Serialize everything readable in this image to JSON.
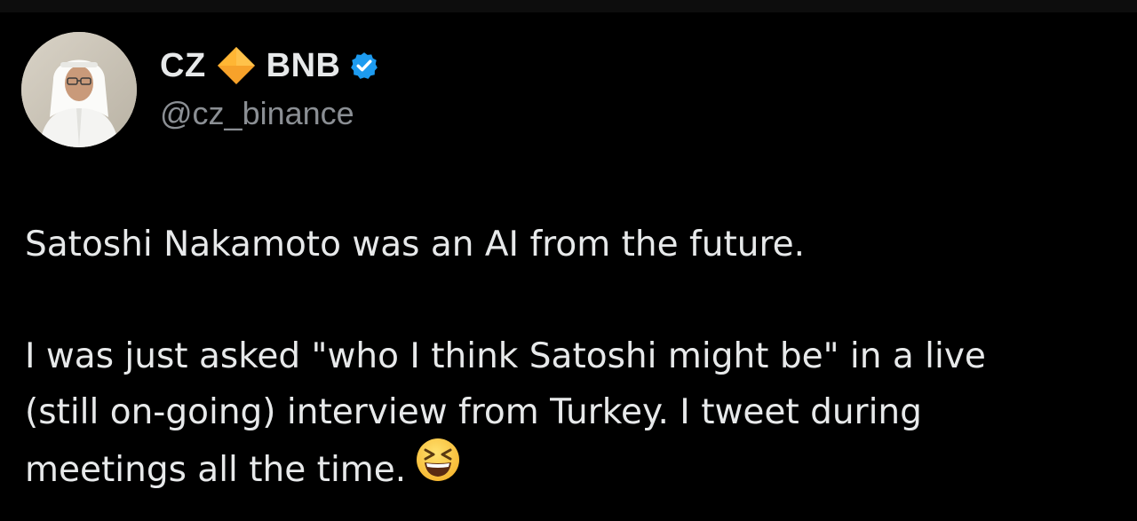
{
  "author": {
    "name_first": "CZ",
    "name_second": "BNB",
    "handle": "@cz_binance",
    "avatar_icon": "avatar-photo",
    "name_icon": "orange-diamond-icon",
    "verified_icon": "verified-badge-icon"
  },
  "tweet": {
    "line1": "Satoshi Nakamoto was an AI from the future.",
    "line2": "I was just asked \"who I think Satoshi might be\" in a live",
    "line3": "(still on-going) interview from Turkey. I tweet during",
    "line4": "meetings all the time.",
    "emoji_icon": "grinning-squinting-face-emoji"
  },
  "colors": {
    "background": "#000000",
    "text": "#e7e9ea",
    "handle": "#8b8f94",
    "verified_blue": "#1d9bf0",
    "diamond_orange": "#f7a22a"
  }
}
